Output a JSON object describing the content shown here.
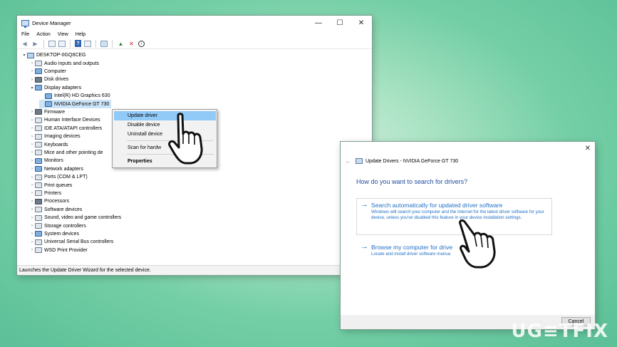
{
  "device_manager": {
    "title": "Device Manager",
    "window_controls": {
      "minimize": "—",
      "maximize": "☐",
      "close": "✕"
    },
    "menu": [
      "File",
      "Action",
      "View",
      "Help"
    ],
    "tree": [
      {
        "label": "DESKTOP-0GQ6CEG",
        "level": 0,
        "caret": "▾",
        "icon": "computer-root"
      },
      {
        "label": "Audio inputs and outputs",
        "level": 1,
        "caret": "›",
        "icon": "speaker"
      },
      {
        "label": "Computer",
        "level": 1,
        "caret": "›",
        "icon": "monitor"
      },
      {
        "label": "Disk drives",
        "level": 1,
        "caret": "›",
        "icon": "disk"
      },
      {
        "label": "Display adapters",
        "level": 1,
        "caret": "▾",
        "icon": "display"
      },
      {
        "label": "Intel(R) HD Graphics 630",
        "level": 2,
        "caret": "",
        "icon": "display"
      },
      {
        "label": "NVIDIA GeForce GT 730",
        "level": 2,
        "caret": "",
        "icon": "display",
        "selected": true
      },
      {
        "label": "Firmware",
        "level": 1,
        "caret": "›",
        "icon": "chip"
      },
      {
        "label": "Human Interface Devices",
        "level": 1,
        "caret": "›",
        "icon": "hid"
      },
      {
        "label": "IDE ATA/ATAPI controllers",
        "level": 1,
        "caret": "›",
        "icon": "controller"
      },
      {
        "label": "Imaging devices",
        "level": 1,
        "caret": "›",
        "icon": "camera"
      },
      {
        "label": "Keyboards",
        "level": 1,
        "caret": "›",
        "icon": "keyboard"
      },
      {
        "label": "Mice and other pointing de",
        "level": 1,
        "caret": "›",
        "icon": "mouse"
      },
      {
        "label": "Monitors",
        "level": 1,
        "caret": "›",
        "icon": "monitor"
      },
      {
        "label": "Network adapters",
        "level": 1,
        "caret": "›",
        "icon": "network"
      },
      {
        "label": "Ports (COM & LPT)",
        "level": 1,
        "caret": "›",
        "icon": "port"
      },
      {
        "label": "Print queues",
        "level": 1,
        "caret": "›",
        "icon": "printer"
      },
      {
        "label": "Printers",
        "level": 1,
        "caret": "›",
        "icon": "printer"
      },
      {
        "label": "Processors",
        "level": 1,
        "caret": "›",
        "icon": "cpu"
      },
      {
        "label": "Software devices",
        "level": 1,
        "caret": "›",
        "icon": "software"
      },
      {
        "label": "Sound, video and game controllers",
        "level": 1,
        "caret": "›",
        "icon": "speaker"
      },
      {
        "label": "Storage controllers",
        "level": 1,
        "caret": "›",
        "icon": "storage"
      },
      {
        "label": "System devices",
        "level": 1,
        "caret": "›",
        "icon": "system"
      },
      {
        "label": "Universal Serial Bus controllers",
        "level": 1,
        "caret": "›",
        "icon": "usb"
      },
      {
        "label": "WSD Print Provider",
        "level": 1,
        "caret": "›",
        "icon": "printer"
      }
    ],
    "context_menu": {
      "update_driver": "Update driver",
      "disable_device": "Disable device",
      "uninstall_device": "Uninstall device",
      "scan": "Scan for hardw",
      "properties": "Properties"
    },
    "status": "Launches the Update Driver Wizard for the selected device."
  },
  "update_dialog": {
    "close": "✕",
    "back": "←",
    "header": "Update Drivers - NVIDIA GeForce GT 730",
    "question": "How do you want to search for drivers?",
    "option1": {
      "title": "Search automatically for updated driver software",
      "desc": "Windows will search your computer and the Internet for the latest driver software for your device, unless you've disabled this feature in your device installation settings."
    },
    "option2": {
      "title": "Browse my computer for drive",
      "desc": "Locate and install driver software manua"
    },
    "cancel": "Cancel"
  },
  "watermark": "UG≡TFIX",
  "colors": {
    "accent_blue": "#1f6fc6",
    "menu_highlight": "#91c9f7",
    "selection": "#cce4f7"
  }
}
